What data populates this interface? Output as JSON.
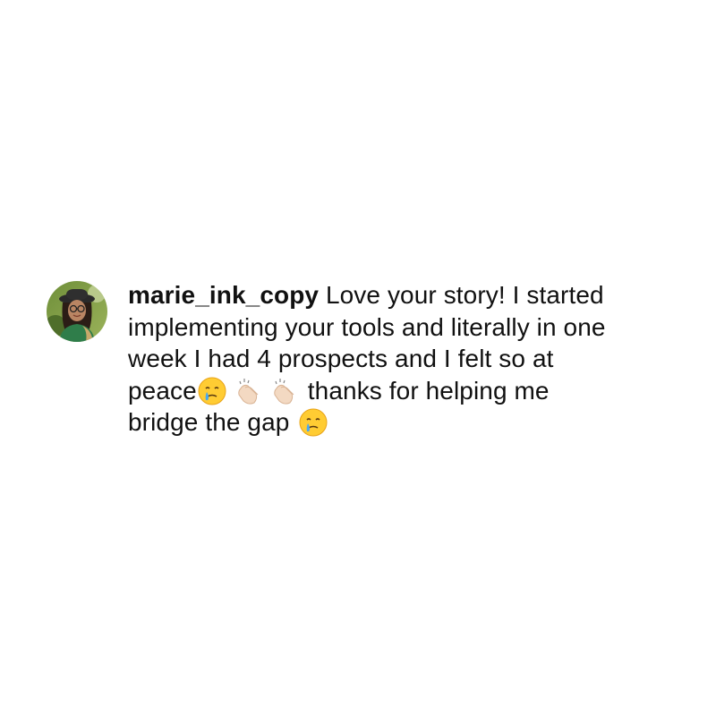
{
  "comment": {
    "avatar_icon": "profile-photo-avatar",
    "username": "marie_ink_copy",
    "lines": [
      " Love your story! I started",
      "implementing your tools and literally in one",
      "week I had 4 prospects and I felt so at",
      "peace",
      "thanks for helping me",
      "bridge the gap"
    ],
    "emojis": {
      "teary_smile": "smiling-face-with-tear-icon",
      "clapping_hands": "clapping-hands-light-skin-icon"
    }
  },
  "colors": {
    "text": "#111111",
    "background": "#ffffff"
  }
}
